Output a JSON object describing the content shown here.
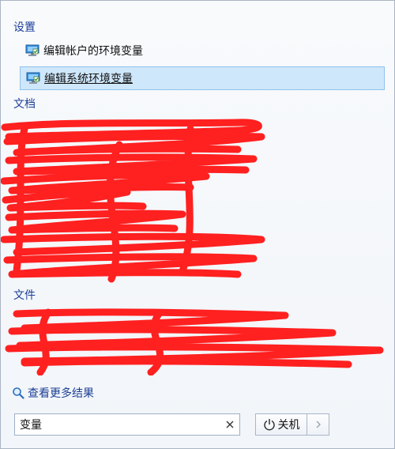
{
  "groups": {
    "settings": {
      "title": "设置",
      "items": [
        {
          "label": "编辑帐户的环境变量",
          "icon": "monitor-settings-icon"
        },
        {
          "label": "编辑系统环境变量",
          "icon": "monitor-settings-icon"
        }
      ]
    },
    "documents": {
      "title": "文档"
    },
    "files": {
      "title": "文件"
    }
  },
  "more_results": {
    "label": "查看更多结果",
    "icon": "search-icon"
  },
  "search": {
    "value": "变量",
    "clear_icon": "close-icon"
  },
  "shutdown": {
    "label": "关机",
    "icon": "power-icon",
    "arrow_icon": "chevron-right-icon"
  },
  "colors": {
    "group_title": "#1e3f99",
    "selected_bg": "#cfe7fb",
    "redaction": "#ff2020"
  }
}
